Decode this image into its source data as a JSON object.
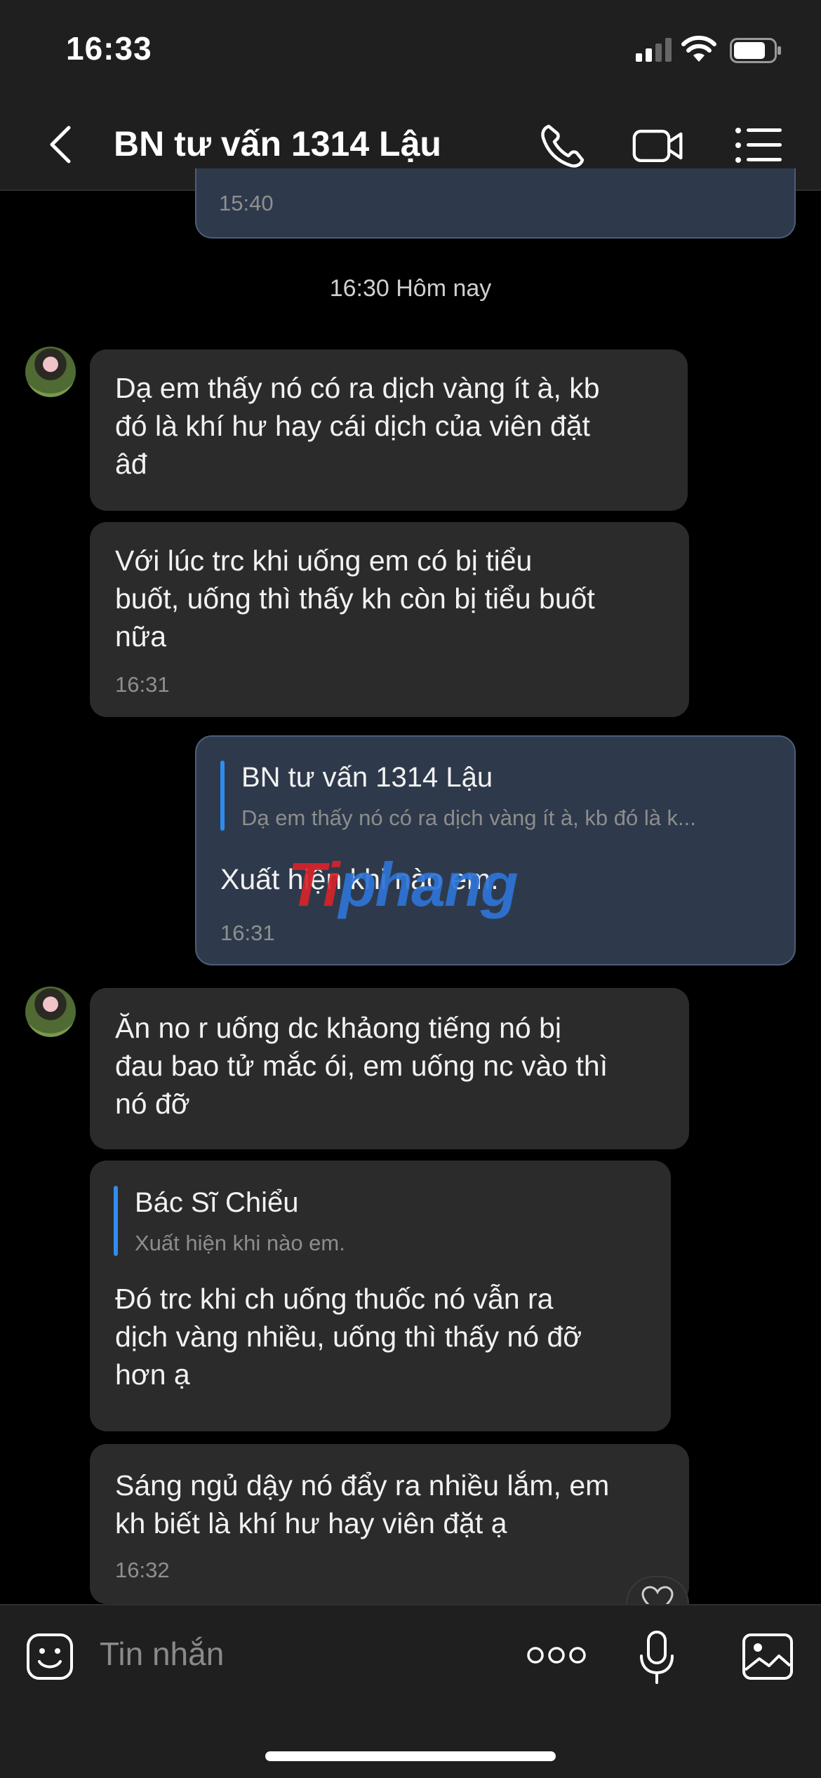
{
  "status_bar": {
    "time": "16:33"
  },
  "header": {
    "title": "BN tư vấn 1314 Lậu"
  },
  "messages": {
    "prev_time": "15:40",
    "date_separator": "16:30 Hôm nay",
    "m1": "Dạ em thấy nó có ra dịch vàng ít à, kb\nđó là khí hư hay cái dịch của viên đặt\nâđ",
    "m2": "Với lúc trc khi uống em có bị tiểu\nbuốt, uống thì thấy kh còn bị tiểu buốt\nnữa",
    "m2_time": "16:31",
    "out_quote_name": "BN tư vấn 1314 Lậu",
    "out_quote_preview": "Dạ em thấy nó có ra dịch vàng ít à, kb đó là k...",
    "out_text": "Xuất hiện khi nào em.",
    "out_time": "16:31",
    "m3": "Ăn no r uống dc khảong tiếng nó bị\nđau bao tử mắc ói, em uống nc vào thì\nnó đỡ",
    "m4_quote_name": "Bác Sĩ Chiểu",
    "m4_quote_preview": "Xuất hiện khi nào em.",
    "m4": "Đó trc khi ch uống thuốc nó vẫn ra\ndịch vàng nhiều, uống thì thấy nó đỡ\nhơn ạ",
    "m5": "Sáng ngủ dậy nó đẩy ra nhiều lắm, em\nkh biết là khí hư hay viên đặt ạ",
    "m5_time": "16:32"
  },
  "composer": {
    "placeholder": "Tin nhắn"
  },
  "watermark": {
    "part1": "Ti",
    "part2": "phang"
  },
  "colors": {
    "accent": "#2f8cf0",
    "incoming": "#2b2b2b",
    "outgoing": "#2e3a4b"
  }
}
